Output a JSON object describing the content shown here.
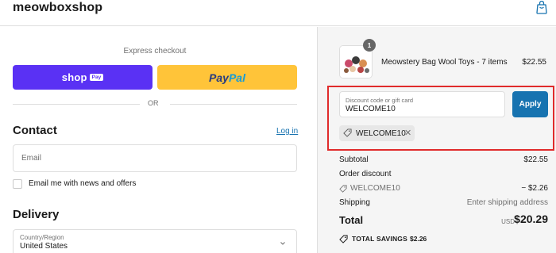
{
  "header": {
    "brand": "meowboxshop",
    "cart_icon": "shopping-bag-icon"
  },
  "express": {
    "label": "Express checkout",
    "shop_word": "shop",
    "shop_pay_badge": "Pay",
    "paypal_part1": "Pay",
    "paypal_part2": "Pal",
    "or": "OR"
  },
  "contact": {
    "heading": "Contact",
    "login_link": "Log in",
    "email_placeholder": "Email",
    "news_label": "Email me with news and offers"
  },
  "delivery": {
    "heading": "Delivery",
    "country_label": "Country/Region",
    "country_value": "United States"
  },
  "order": {
    "quantity_badge": "1",
    "product_name": "Meowstery Bag Wool Toys - 7 items",
    "product_price": "$22.55",
    "discount_label": "Discount code or gift card",
    "discount_value": "WELCOME10",
    "apply_label": "Apply",
    "applied_code": "WELCOME10",
    "remove_symbol": "✕",
    "subtotal_label": "Subtotal",
    "subtotal_value": "$22.55",
    "order_discount_label": "Order discount",
    "discount_code": "WELCOME10",
    "discount_amount": "− $2.26",
    "shipping_label": "Shipping",
    "shipping_value": "Enter shipping address",
    "total_label": "Total",
    "total_currency": "USD",
    "total_value": "$20.29",
    "savings_label": "TOTAL SAVINGS",
    "savings_value": "$2.26"
  },
  "colors": {
    "shop_pay": "#5a31f4",
    "paypal": "#ffc439",
    "accent_blue": "#1773b0",
    "highlight_red": "#e02b2b"
  }
}
